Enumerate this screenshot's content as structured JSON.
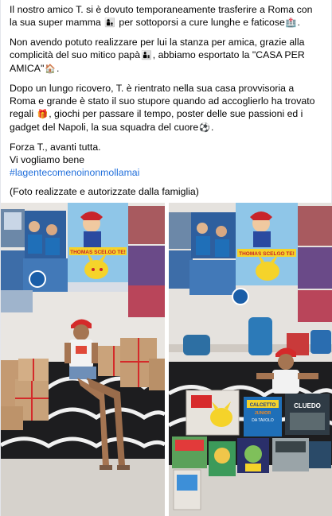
{
  "post": {
    "p1": {
      "a": "Il nostro amico T. si è dovuto temporaneamente trasferire a Roma  con",
      "b1": "la sua super mamma ",
      "b_emoji1": "👩‍👦",
      "b2": " per sottoporsi a cure lunghe e faticose",
      "b_emoji2": "🏥",
      "b3": "."
    },
    "p2": {
      "a": "Non avendo potuto realizzare per lui la stanza per amica, grazie alla",
      "b1": "complicità del suo mitico papà",
      "b_emoji": "👨‍👦",
      "b2": ", abbiamo esportato la \"CASA PER",
      "c1": "AMICA\"",
      "c_emoji": "🏠",
      "c2": "."
    },
    "p3": {
      "a": "Dopo un lungo ricovero, T. è rientrato nella sua casa provvisoria a",
      "b": "Roma e grande è stato il suo stupore quando ad accoglierlo ha trovato",
      "c1": "regali ",
      "c_emoji": "🎁",
      "c2": ", giochi per passare il tempo,  poster delle sue passioni ed i",
      "d1": "gadget del Napoli, la sua squadra del cuore",
      "d_emoji": "⚽",
      "d2": "."
    },
    "p4": {
      "a": "Forza T., avanti tutta.",
      "b": "Vi vogliamo bene",
      "hashtag": "#lagentecomenoinonmollamai"
    },
    "p5": "(Foto realizzate e autorizzate dalla famiglia)"
  },
  "photos": {
    "left": {
      "poster_text": "THOMAS SCELGO TE!"
    },
    "right": {
      "poster_text": "THOMAS SCELGO TE!",
      "box_text_1": "CALCETTO",
      "box_text_2": "JUNIOR",
      "box_text_3": "DA TAVOLO",
      "box_text_4": "CLUEDO"
    }
  },
  "colors": {
    "text": "#050505",
    "hashtag": "#216fdb",
    "napoli_blue": "#1f6fb8",
    "pikachu": "#f5d32a"
  }
}
